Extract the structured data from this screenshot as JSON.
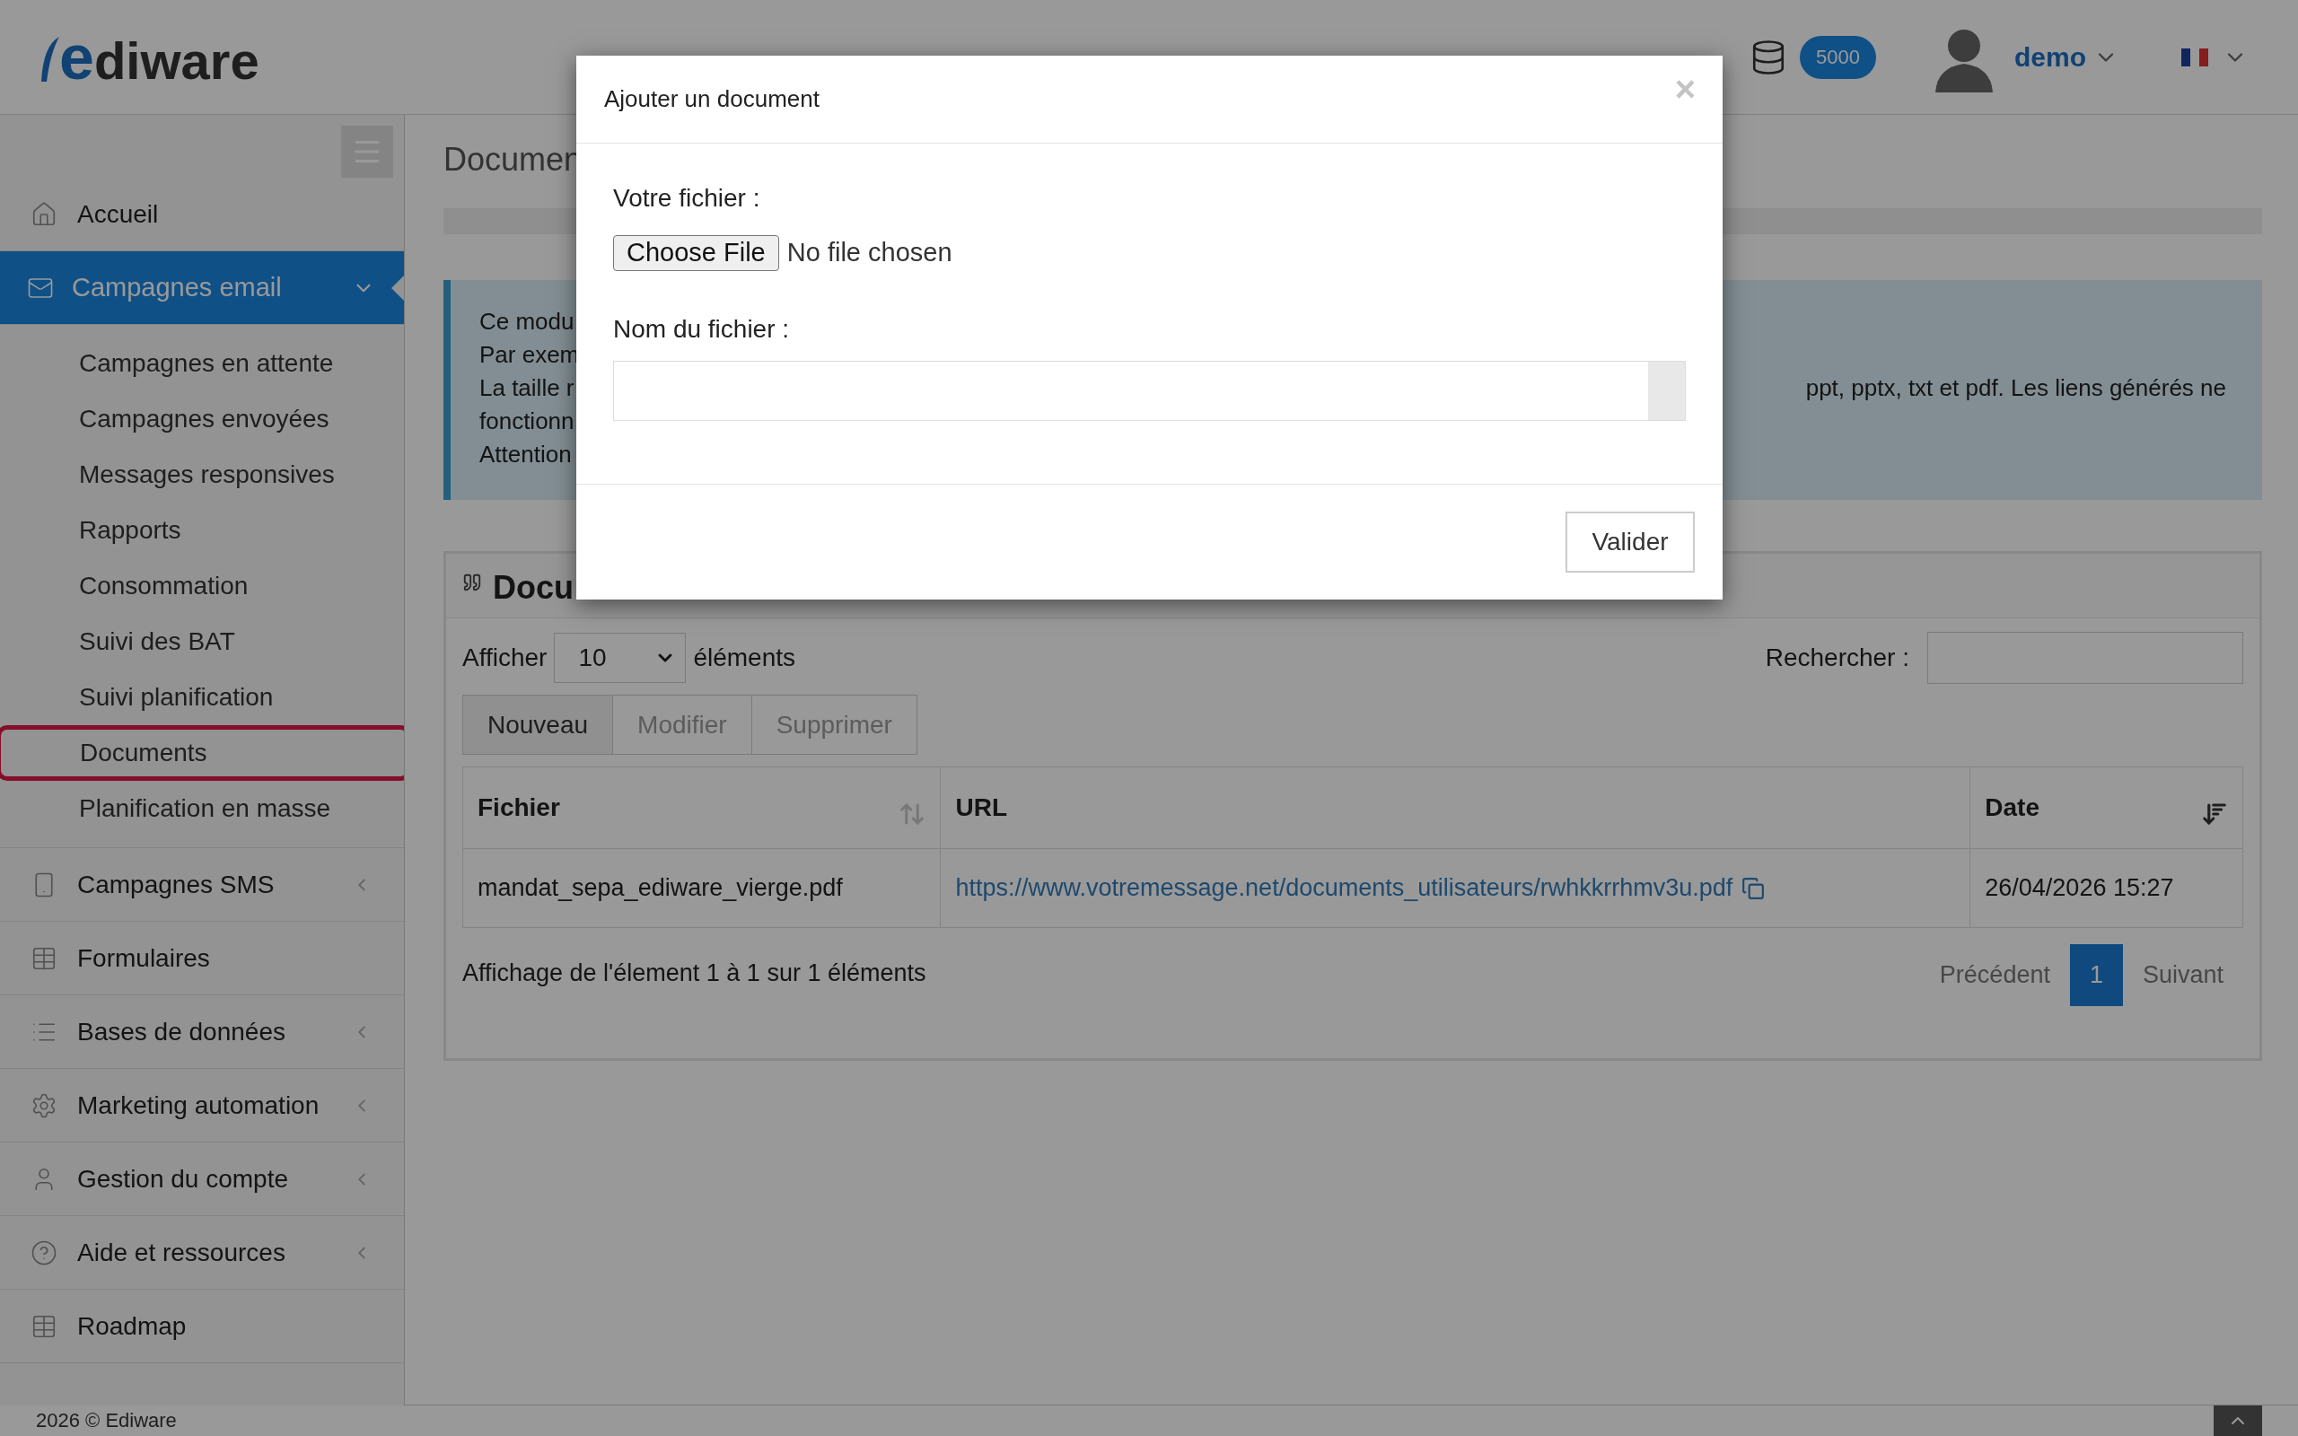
{
  "header": {
    "logo": {
      "mark": "e",
      "text": "diware"
    },
    "credits_badge": "5000",
    "user": "demo"
  },
  "sidebar": {
    "items": [
      {
        "kind": "link",
        "label": "Accueil",
        "selected": false
      },
      {
        "kind": "group",
        "label": "Campagnes email",
        "selected": true,
        "expanded": true,
        "children": [
          {
            "label": "Campagnes en attente",
            "highlighted": false
          },
          {
            "label": "Campagnes envoyées",
            "highlighted": false
          },
          {
            "label": "Messages responsives",
            "highlighted": false
          },
          {
            "label": "Rapports",
            "highlighted": false
          },
          {
            "label": "Consommation",
            "highlighted": false
          },
          {
            "label": "Suivi des BAT",
            "highlighted": false
          },
          {
            "label": "Suivi planification",
            "highlighted": false
          },
          {
            "label": "Documents",
            "highlighted": true
          },
          {
            "label": "Planification en masse",
            "highlighted": false
          }
        ]
      },
      {
        "kind": "group",
        "label": "Campagnes SMS",
        "selected": false,
        "expanded": false
      },
      {
        "kind": "link",
        "label": "Formulaires",
        "selected": false
      },
      {
        "kind": "group",
        "label": "Bases de données",
        "selected": false,
        "expanded": false
      },
      {
        "kind": "group",
        "label": "Marketing automation",
        "selected": false,
        "expanded": false
      },
      {
        "kind": "group",
        "label": "Gestion du compte",
        "selected": false,
        "expanded": false
      },
      {
        "kind": "group",
        "label": "Aide et ressources",
        "selected": false,
        "expanded": false
      },
      {
        "kind": "link",
        "label": "Roadmap",
        "selected": false
      }
    ]
  },
  "page": {
    "title": "Documen",
    "info": {
      "left": [
        "Ce modu",
        "Par exem",
        "La taille r",
        "fonctionn",
        "Attention"
      ],
      "right": "ppt, pptx, txt et pdf. Les liens générés ne"
    },
    "panel": {
      "title": "Docu",
      "length_label": "Afficher",
      "length_value": "10",
      "length_suffix": "éléments",
      "search_label": "Rechercher :",
      "toolbar": [
        {
          "label": "Nouveau",
          "disabled": false
        },
        {
          "label": "Modifier",
          "disabled": true
        },
        {
          "label": "Supprimer",
          "disabled": true
        }
      ],
      "table": {
        "columns": [
          {
            "label": "Fichier",
            "sortable": true,
            "sorted": false
          },
          {
            "label": "URL",
            "sortable": false
          },
          {
            "label": "Date",
            "sortable": true,
            "sorted": true
          }
        ],
        "rows": [
          {
            "file": "mandat_sepa_ediware_vierge.pdf",
            "url": "https://www.votremessage.net/documents_utilisateurs/rwhkkrrhmv3u.pdf",
            "date": "26/04/2026 15:27"
          }
        ]
      },
      "summary": "Affichage de l'élement 1 à 1 sur 1 éléments",
      "pagination": {
        "previous": "Précédent",
        "pages": [
          {
            "label": "1",
            "selected": true
          }
        ],
        "next": "Suivant"
      }
    }
  },
  "modal": {
    "title": "Ajouter un document",
    "close": "×",
    "file_label": "Votre fichier :",
    "file_button": "Choose File",
    "file_status": "No file chosen",
    "name_label": "Nom du fichier :",
    "submit": "Valider"
  },
  "footer": {
    "copyright": "2026 © Ediware"
  }
}
